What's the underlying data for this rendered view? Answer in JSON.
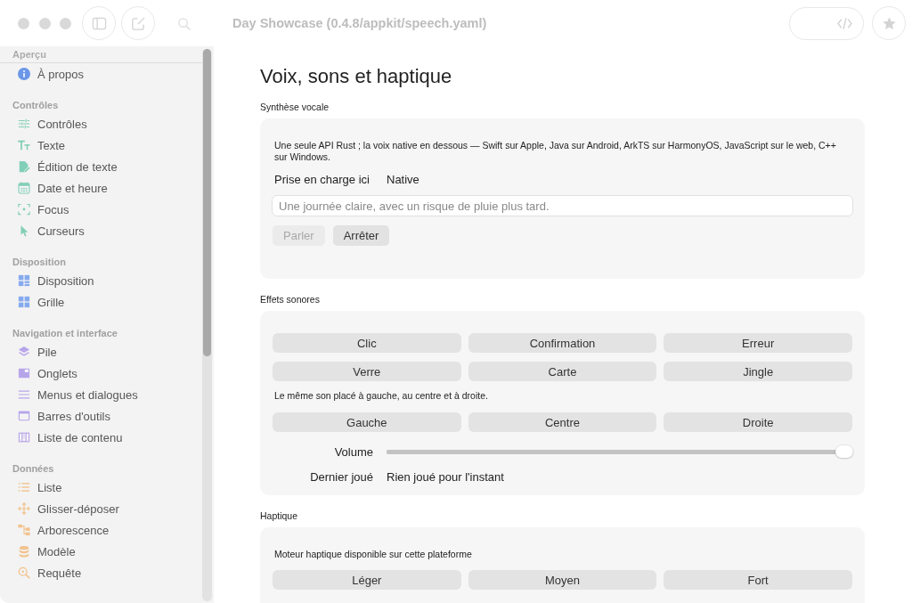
{
  "window": {
    "title": "Day Showcase (0.4.8/appkit/speech.yaml)"
  },
  "sidebar": {
    "sections": [
      {
        "title": "Aperçu",
        "items": [
          {
            "label": "À propos",
            "kind": "info",
            "selected": false
          }
        ]
      },
      {
        "title": "Contrôles",
        "items": [
          {
            "label": "Contrôles",
            "kind": "sliders",
            "selected": false
          },
          {
            "label": "Texte",
            "kind": "text",
            "selected": false
          },
          {
            "label": "Édition de texte",
            "kind": "edit",
            "selected": false
          },
          {
            "label": "Date et heure",
            "kind": "calendar",
            "selected": false
          },
          {
            "label": "Focus",
            "kind": "focus",
            "selected": false
          },
          {
            "label": "Curseurs",
            "kind": "cursor",
            "selected": false
          }
        ]
      },
      {
        "title": "Disposition",
        "items": [
          {
            "label": "Disposition",
            "kind": "layout",
            "selected": false
          },
          {
            "label": "Grille",
            "kind": "grid",
            "selected": false
          }
        ]
      },
      {
        "title": "Navigation et interface",
        "items": [
          {
            "label": "Pile",
            "kind": "stack",
            "selected": false
          },
          {
            "label": "Onglets",
            "kind": "tabs",
            "selected": false
          },
          {
            "label": "Menus et dialogues",
            "kind": "menu",
            "selected": false
          },
          {
            "label": "Barres d'outils",
            "kind": "toolbar",
            "selected": false
          },
          {
            "label": "Liste de contenu",
            "kind": "columns",
            "selected": false
          }
        ]
      },
      {
        "title": "Données",
        "items": [
          {
            "label": "Liste",
            "kind": "list",
            "selected": false
          },
          {
            "label": "Glisser-déposer",
            "kind": "move",
            "selected": false
          },
          {
            "label": "Arborescence",
            "kind": "tree",
            "selected": false
          },
          {
            "label": "Modèle",
            "kind": "database",
            "selected": false
          },
          {
            "label": "Requête",
            "kind": "query",
            "selected": false
          }
        ]
      }
    ]
  },
  "page": {
    "title": "Voix, sons et haptique"
  },
  "speech": {
    "heading": "Synthèse vocale",
    "description": "Une seule API Rust ; la voix native en dessous — Swift sur Apple, Java sur Android, ArkTS sur HarmonyOS, JavaScript sur le web, C++ sur Windows.",
    "support": {
      "label": "Prise en charge ici",
      "value": "Native"
    },
    "text_field": {
      "placeholder": "Une journée claire, avec un risque de pluie plus tard."
    },
    "buttons": [
      {
        "label": "Parler",
        "disabled": true
      },
      {
        "label": "Arrêter",
        "disabled": false
      }
    ]
  },
  "sound_effects": {
    "heading": "Effets sonores",
    "sounds": [
      "Clic",
      "Confirmation",
      "Erreur",
      "Verre",
      "Carte",
      "Jingle"
    ],
    "pan_note": "Le même son placé à gauche, au centre et à droite.",
    "pan_buttons": [
      "Gauche",
      "Centre",
      "Droite"
    ],
    "volume": {
      "label": "Volume",
      "level": 1
    },
    "last_played": {
      "label": "Dernier joué",
      "value": "Rien joué pour l'instant"
    }
  },
  "haptics": {
    "heading": "Haptique",
    "status": "Moteur haptique disponible sur cette plateforme",
    "buttons": [
      "Léger",
      "Moyen",
      "Fort"
    ]
  }
}
